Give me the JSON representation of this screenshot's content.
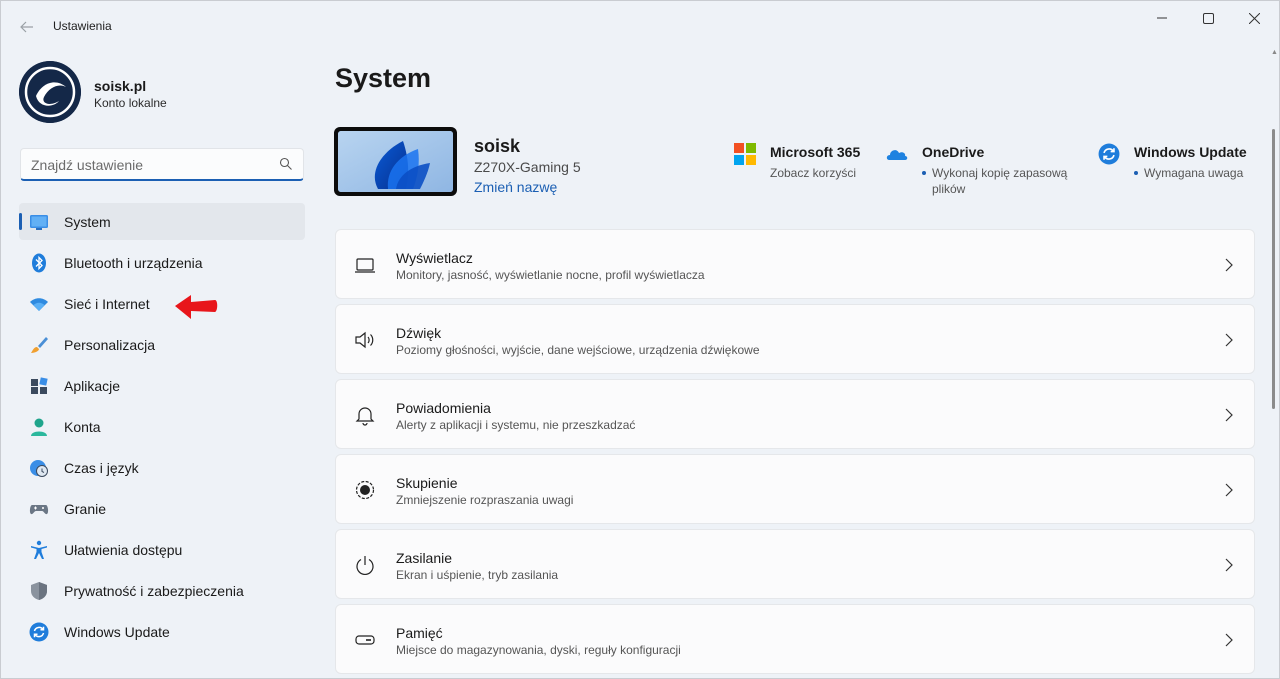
{
  "window": {
    "title": "Ustawienia"
  },
  "profile": {
    "name": "soisk.pl",
    "account": "Konto lokalne"
  },
  "search": {
    "placeholder": "Znajdź ustawienie"
  },
  "nav": {
    "items": [
      {
        "label": "System",
        "icon": "system-icon",
        "active": true
      },
      {
        "label": "Bluetooth i urządzenia",
        "icon": "bluetooth-icon"
      },
      {
        "label": "Sieć i Internet",
        "icon": "wifi-icon"
      },
      {
        "label": "Personalizacja",
        "icon": "brush-icon"
      },
      {
        "label": "Aplikacje",
        "icon": "apps-icon"
      },
      {
        "label": "Konta",
        "icon": "person-icon"
      },
      {
        "label": "Czas i język",
        "icon": "clock-globe-icon"
      },
      {
        "label": "Granie",
        "icon": "gamepad-icon"
      },
      {
        "label": "Ułatwienia dostępu",
        "icon": "accessibility-icon"
      },
      {
        "label": "Prywatność i zabezpieczenia",
        "icon": "shield-icon"
      },
      {
        "label": "Windows Update",
        "icon": "update-icon"
      }
    ]
  },
  "main": {
    "title": "System",
    "device": {
      "name": "soisk",
      "model": "Z270X-Gaming 5",
      "rename": "Zmień nazwę"
    },
    "quick": [
      {
        "title": "Microsoft 365",
        "sub": "Zobacz korzyści",
        "icon": "microsoft-logo-icon"
      },
      {
        "title": "OneDrive",
        "sub": "Wykonaj kopię zapasową",
        "sub2": "plików",
        "icon": "onedrive-icon"
      },
      {
        "title": "Windows Update",
        "sub": "Wymagana uwaga",
        "icon": "update-icon"
      }
    ],
    "cards": [
      {
        "title": "Wyświetlacz",
        "sub": "Monitory, jasność, wyświetlanie nocne, profil wyświetlacza",
        "icon": "display-icon"
      },
      {
        "title": "Dźwięk",
        "sub": "Poziomy głośności, wyjście, dane wejściowe, urządzenia dźwiękowe",
        "icon": "speaker-icon"
      },
      {
        "title": "Powiadomienia",
        "sub": "Alerty z aplikacji i systemu, nie przeszkadzać",
        "icon": "bell-icon"
      },
      {
        "title": "Skupienie",
        "sub": "Zmniejszenie rozpraszania uwagi",
        "icon": "focus-icon"
      },
      {
        "title": "Zasilanie",
        "sub": "Ekran i uśpienie, tryb zasilania",
        "icon": "power-icon"
      },
      {
        "title": "Pamięć",
        "sub": "Miejsce do magazynowania, dyski, reguły konfiguracji",
        "icon": "storage-icon"
      }
    ]
  },
  "colors": {
    "accent": "#1b5fb3",
    "annotation_arrow": "#e8161b"
  }
}
